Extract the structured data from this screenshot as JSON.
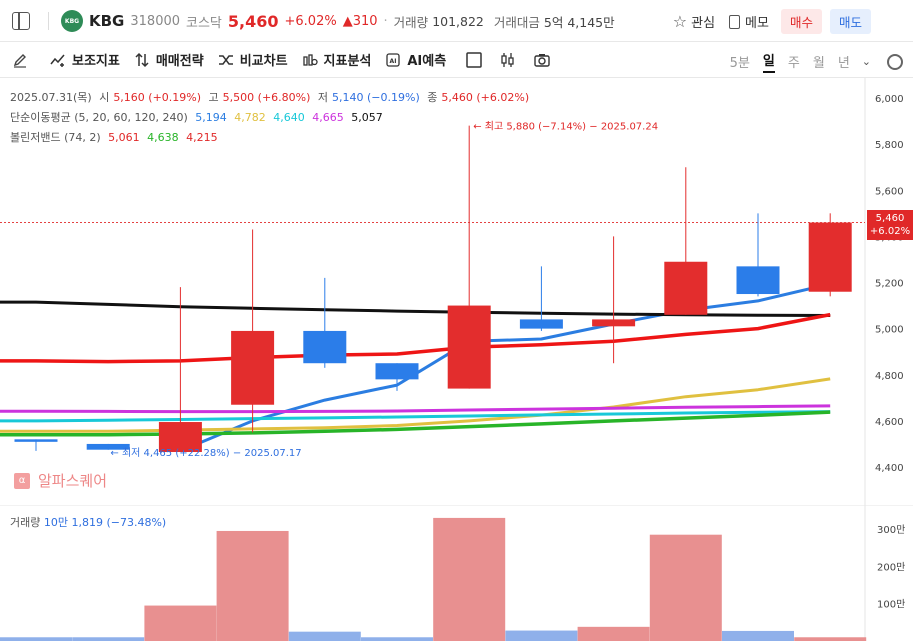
{
  "header": {
    "name": "KBG",
    "logo_text": "KBG",
    "code": "318000",
    "market": "코스닥",
    "price": "5,460",
    "change_pct": "+6.02%",
    "change_abs": "▲310",
    "volume_label": "거래량",
    "volume_value": "101,822",
    "amount_label": "거래대금",
    "amount_value": "5억 4,145만",
    "watch_label": "관심",
    "memo_label": "메모",
    "buy_label": "매수",
    "sell_label": "매도"
  },
  "toolbar": {
    "items": [
      "보조지표",
      "매매전략",
      "비교차트",
      "지표분석",
      "AI예측"
    ],
    "periods": [
      "5분",
      "일",
      "주",
      "월",
      "년"
    ],
    "active_period": "일"
  },
  "info": {
    "date": "2025.07.31(목)",
    "open_label": "시",
    "open": "5,160 (+0.19%)",
    "high_label": "고",
    "high": "5,500 (+6.80%)",
    "low_label": "저",
    "low": "5,140 (−0.19%)",
    "close_label": "종",
    "close": "5,460 (+6.02%)",
    "ma_label": "단순이동평균 (5, 20, 60, 120, 240)",
    "ma_values": [
      "5,194",
      "4,782",
      "4,640",
      "4,665",
      "5,057"
    ],
    "bb_label": "볼린저밴드 (74, 2)",
    "bb_values": [
      "5,061",
      "4,638",
      "4,215"
    ]
  },
  "watermark": "알파스퀘어",
  "volume_info": {
    "label": "거래량",
    "value": "10만 1,819 (−73.48%)"
  },
  "price_tag": {
    "price": "5,460",
    "pct": "+6.02%"
  },
  "colors": {
    "up": "#e02828",
    "down": "#2f6fdf",
    "candle_up": "#e32d2d",
    "candle_down": "#2b7de9",
    "vol_up": "#e89090",
    "vol_down": "#8fb0ea"
  },
  "chart_data": {
    "type": "candlestick",
    "y_ticks": [
      4400,
      4600,
      4800,
      5000,
      5200,
      5400,
      5600,
      5800,
      6000
    ],
    "candles": [
      {
        "open": 4520,
        "close": 4510,
        "high": 4520,
        "low": 4470
      },
      {
        "open": 4500,
        "close": 4475,
        "high": 4500,
        "low": 4475
      },
      {
        "open": 4465,
        "close": 4595,
        "high": 5180,
        "low": 4465
      },
      {
        "open": 4670,
        "close": 4990,
        "high": 5430,
        "low": 4550
      },
      {
        "open": 4990,
        "close": 4850,
        "high": 5220,
        "low": 4830
      },
      {
        "open": 4850,
        "close": 4780,
        "high": 4850,
        "low": 4730
      },
      {
        "open": 4740,
        "close": 5100,
        "high": 5880,
        "low": 4740
      },
      {
        "open": 5040,
        "close": 5000,
        "high": 5270,
        "low": 4990
      },
      {
        "open": 5010,
        "close": 5040,
        "high": 5400,
        "low": 4850
      },
      {
        "open": 5060,
        "close": 5290,
        "high": 5700,
        "low": 5060
      },
      {
        "open": 5270,
        "close": 5150,
        "high": 5500,
        "low": 5140
      },
      {
        "open": 5160,
        "close": 5460,
        "high": 5500,
        "low": 5140
      }
    ],
    "ma_lines": [
      {
        "name": "ma5",
        "color": "#2b7de1",
        "width": 3,
        "values": [
          null,
          null,
          4470,
          4600,
          4690,
          4755,
          4945,
          4955,
          5020,
          5080,
          5120,
          5194
        ]
      },
      {
        "name": "ma20",
        "color": "#e0c040",
        "width": 3,
        "values": [
          4555,
          4555,
          4560,
          4565,
          4570,
          4580,
          4600,
          4625,
          4660,
          4705,
          4735,
          4782
        ]
      },
      {
        "name": "ma60",
        "color": "#18c8d8",
        "width": 3,
        "values": [
          4600,
          4603,
          4606,
          4610,
          4613,
          4617,
          4621,
          4626,
          4630,
          4634,
          4637,
          4640
        ]
      },
      {
        "name": "ma120",
        "color": "#cc33dd",
        "width": 3,
        "values": [
          4642,
          4641,
          4640,
          4640,
          4641,
          4643,
          4647,
          4651,
          4655,
          4659,
          4662,
          4665
        ]
      },
      {
        "name": "ma240",
        "color": "#111111",
        "width": 3,
        "values": [
          5115,
          5105,
          5095,
          5088,
          5082,
          5076,
          5071,
          5067,
          5063,
          5060,
          5058,
          5057
        ]
      },
      {
        "name": "bb_upper",
        "color": "#ee1515",
        "width": 3.5,
        "values": [
          4860,
          4857,
          4860,
          4875,
          4885,
          4890,
          4920,
          4930,
          4945,
          4975,
          5000,
          5061
        ]
      },
      {
        "name": "bb_mid",
        "color": "#28b428",
        "width": 3.5,
        "values": [
          4540,
          4540,
          4543,
          4548,
          4555,
          4563,
          4575,
          4587,
          4600,
          4612,
          4624,
          4638
        ]
      }
    ],
    "annotations": {
      "high_text": "최고 5,880 (−7.14%) − 2025.07.24",
      "low_text": "최저 4,465 (+22.28%) − 2025.07.17"
    },
    "volume": {
      "y_ticks": [
        100000,
        200000,
        300000
      ],
      "y_tick_labels": [
        "100만",
        "200만",
        "300만"
      ],
      "values": [
        10000,
        10000,
        95000,
        295000,
        25000,
        10000,
        330000,
        28000,
        38000,
        285000,
        27000,
        10000
      ],
      "up": [
        false,
        false,
        true,
        true,
        false,
        false,
        true,
        false,
        true,
        true,
        false,
        true
      ]
    }
  }
}
